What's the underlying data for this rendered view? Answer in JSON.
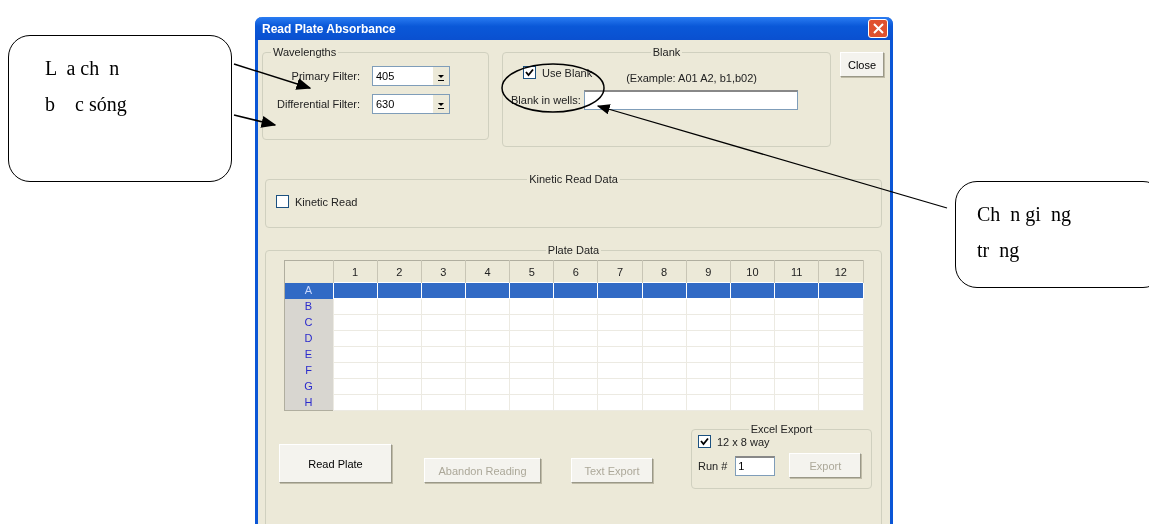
{
  "callouts": [
    {
      "kind": "left",
      "lines": [
        "L  a ch  n",
        "b    c sóng"
      ]
    },
    {
      "kind": "right",
      "lines": [
        "Ch  n gi  ng",
        "tr  ng"
      ]
    }
  ],
  "window": {
    "title": "Read Plate Absorbance"
  },
  "wavelengths": {
    "title": "Wavelengths",
    "filters": [
      {
        "label": "Primary Filter:",
        "value": "405"
      },
      {
        "label": "Differential Filter:",
        "value": "630"
      }
    ]
  },
  "blank": {
    "title": "Blank",
    "use_blank": {
      "label": "Use Blank",
      "checked": true
    },
    "example": "(Example: A01 A2, b1,b02)",
    "wells_label": "Blank in wells:"
  },
  "close_button": "Close",
  "kinetic": {
    "title": "Kinetic Read Data",
    "checkbox": {
      "label": "Kinetic Read",
      "checked": false
    }
  },
  "plate": {
    "title": "Plate Data",
    "columns": [
      "1",
      "2",
      "3",
      "4",
      "5",
      "6",
      "7",
      "8",
      "9",
      "10",
      "11",
      "12"
    ],
    "rows": [
      {
        "label": "A",
        "selected": true
      },
      {
        "label": "B",
        "selected": false
      },
      {
        "label": "C",
        "selected": false
      },
      {
        "label": "D",
        "selected": false
      },
      {
        "label": "E",
        "selected": false
      },
      {
        "label": "F",
        "selected": false
      },
      {
        "label": "G",
        "selected": false
      },
      {
        "label": "H",
        "selected": false
      }
    ]
  },
  "buttons": [
    {
      "label": "Read Plate",
      "disabled": false
    },
    {
      "label": "Abandon Reading",
      "disabled": true
    },
    {
      "label": "Text Export",
      "disabled": true
    }
  ],
  "excel": {
    "title": "Excel Export",
    "checkbox": {
      "label": "12 x 8 way",
      "checked": true
    },
    "run_label": "Run #",
    "run_value": "1",
    "export": {
      "label": "Export",
      "disabled": true
    }
  }
}
